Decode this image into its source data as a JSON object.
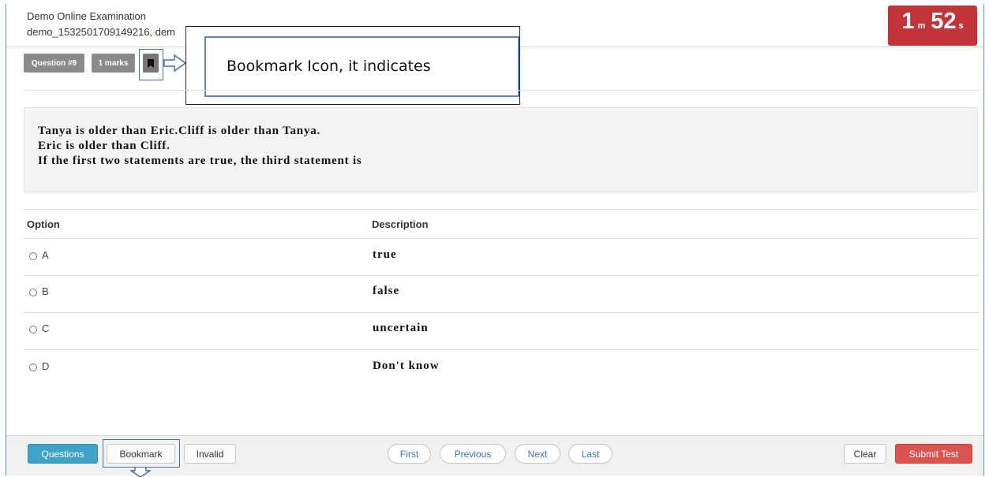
{
  "header": {
    "title": "Demo Online Examination",
    "subtitle": "demo_1532501709149216, dem"
  },
  "timer": {
    "minutes": "1",
    "minutes_unit": "m",
    "seconds": "52",
    "seconds_unit": "s",
    "color": "#c2343a"
  },
  "question_meta": {
    "number_badge": "Question #9",
    "marks_badge": "1 marks",
    "bookmark_icon": "bookmark-icon"
  },
  "callout": {
    "text": "Bookmark Icon, it indicates"
  },
  "question": {
    "lines": [
      "Tanya is older than Eric.Cliff is older than Tanya.",
      "Eric is older than Cliff.",
      "If the first two statements are true, the third statement is"
    ]
  },
  "options_table": {
    "headers": [
      "Option",
      "Description"
    ],
    "rows": [
      {
        "letter": "A",
        "description": "true"
      },
      {
        "letter": "B",
        "description": "false"
      },
      {
        "letter": "C",
        "description": "uncertain"
      },
      {
        "letter": "D",
        "description": "Don't know"
      }
    ]
  },
  "footer": {
    "questions": "Questions",
    "bookmark": "Bookmark",
    "invalid": "Invalid",
    "first": "First",
    "previous": "Previous",
    "next": "Next",
    "last": "Last",
    "clear": "Clear",
    "submit": "Submit Test"
  },
  "colors": {
    "primary": "#3fa2c8",
    "danger": "#d9534f",
    "annotation": "#4a6ea8"
  }
}
